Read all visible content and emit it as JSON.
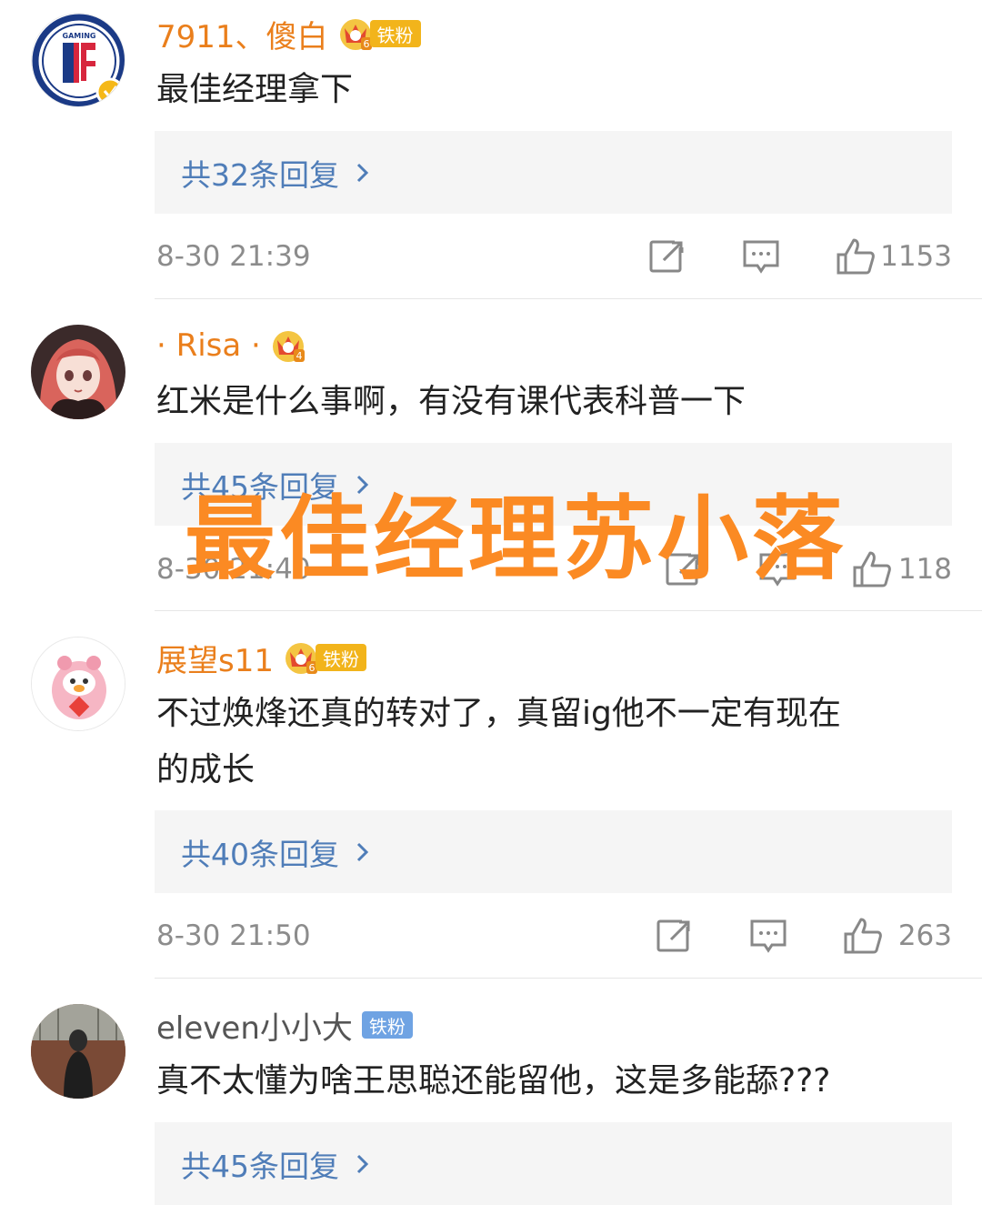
{
  "comments": [
    {
      "username": "7911、傻白",
      "badge_level": "6",
      "badge_label": "铁粉",
      "text": "最佳经理拿下",
      "replies": "共32条回复",
      "time": "8-30 21:39",
      "likes": "1153",
      "avatar_logo_text": "GAMING"
    },
    {
      "username": "· Risa ·",
      "badge_level": "4",
      "text": "红米是什么事啊，有没有课代表科普一下",
      "replies": "共45条回复",
      "time": "8-30 21:40",
      "likes": "118"
    },
    {
      "username": "展望s11",
      "badge_level": "6",
      "badge_label": "铁粉",
      "text_line1": "不过焕烽还真的转对了，真留ig他不一定有现在",
      "text_line2": "的成长",
      "replies": "共40条回复",
      "time": "8-30 21:50",
      "likes": "263"
    },
    {
      "username": "eleven小小大",
      "badge_label": "铁粉",
      "text": "真不太懂为啥王思聪还能留他，这是多能舔???",
      "replies": "共45条回复"
    }
  ],
  "watermark": "最佳经理苏小落",
  "colors": {
    "username": "#ea7f1c",
    "reply_link": "#4f7db8",
    "watermark": "#fb8a23"
  },
  "icons": [
    "share-icon",
    "comment-icon",
    "like-icon",
    "chevron-right-icon",
    "crown-icon"
  ]
}
